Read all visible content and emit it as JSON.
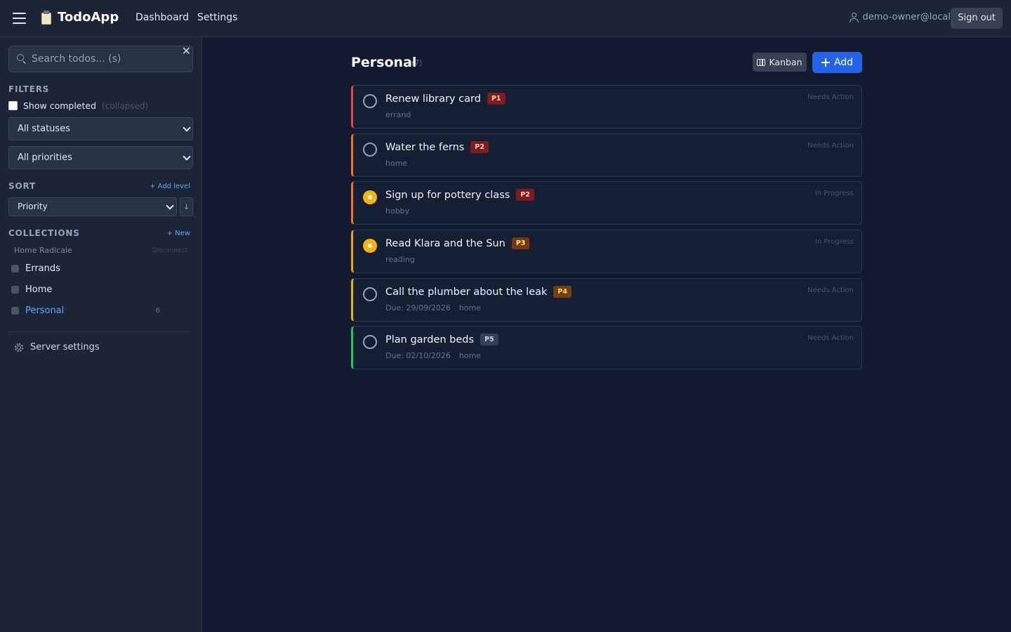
{
  "header": {
    "app_name": "TodoApp",
    "nav": [
      "Dashboard",
      "Settings"
    ],
    "user": "demo-owner@local",
    "sign_out": "Sign out"
  },
  "sidebar": {
    "search_placeholder": "Search todos... (s)",
    "clear_label": "✕",
    "filters_title": "FILTERS",
    "show_completed_label": "Show completed",
    "show_completed_hint": "(collapsed)",
    "status_select": "All statuses",
    "priority_select": "All priorities",
    "sort_title": "SORT",
    "add_level": "+ Add level",
    "sort_field": "Priority",
    "sort_direction": "↓",
    "collections_title": "COLLECTIONS",
    "new_collection": "+ New",
    "account": "Home Radicale",
    "disconnect": "Disconnect",
    "collections": [
      {
        "name": "Errands",
        "count": ""
      },
      {
        "name": "Home",
        "count": ""
      },
      {
        "name": "Personal",
        "count": "6"
      }
    ],
    "server_settings": "Server settings"
  },
  "main": {
    "title": "Personal",
    "count": "(7)",
    "kanban_label": "Kanban",
    "add_label": "Add",
    "todos": [
      {
        "title": "Renew library card",
        "priority": "P1",
        "meta": [
          "errand"
        ],
        "status": "Needs Action"
      },
      {
        "title": "Water the ferns",
        "priority": "P2",
        "meta": [
          "home"
        ],
        "status": "Needs Action"
      },
      {
        "title": "Sign up for pottery class",
        "priority": "P2",
        "meta": [
          "hobby"
        ],
        "status": "In Progress"
      },
      {
        "title": "Read Klara and the Sun",
        "priority": "P3",
        "meta": [
          "reading"
        ],
        "status": "In Progress"
      },
      {
        "title": "Call the plumber about the leak",
        "priority": "P4",
        "meta": [
          "Due: 29/09/2026",
          "home"
        ],
        "status": "Needs Action"
      },
      {
        "title": "Plan garden beds",
        "priority": "P5",
        "meta": [
          "Due: 02/10/2026",
          "home"
        ],
        "status": "Needs Action"
      }
    ]
  },
  "colors": {
    "accent": "#2563eb",
    "p1_border": "#ef4444",
    "p2_border": "#f97316",
    "p3_border": "#f59e0b",
    "p4_border": "#eab308",
    "p5_border": "#22c55e",
    "in_progress": "#f5b40a"
  }
}
